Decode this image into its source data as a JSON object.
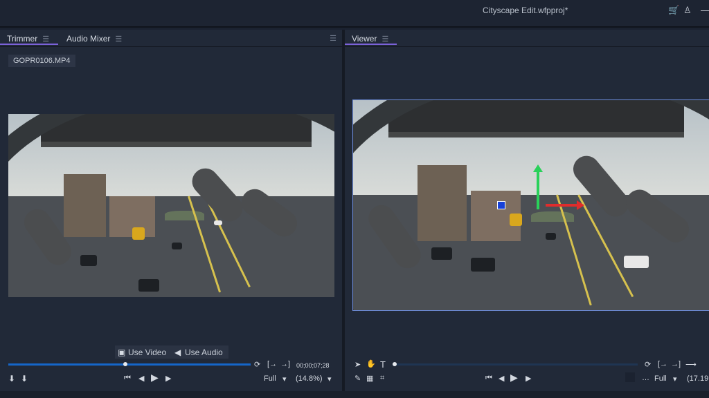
{
  "window": {
    "title": "Cityscape Edit.wfpproj*",
    "icons": [
      "cart-icon",
      "user-icon",
      "minimize-icon"
    ]
  },
  "left_panel": {
    "tabs": [
      {
        "label": "Trimmer",
        "active": true
      },
      {
        "label": "Audio Mixer",
        "active": false
      }
    ],
    "clip_name": "GOPR0106.MP4",
    "source_buttons": {
      "video": "Use Video",
      "audio": "Use Audio"
    },
    "timecode": "00;00;07;28",
    "playback_quality": "Full",
    "zoom": "(14.8%)",
    "timeline_progress": 0.48
  },
  "right_panel": {
    "tab": "Viewer",
    "playback_quality": "Full",
    "zoom": "(17.19",
    "timeline_progress": 0.0
  },
  "colors": {
    "accent": "#7b62d9",
    "selection": "#6f8fde",
    "overlay_blue": "#1741d8",
    "overlay_green": "#29d15a",
    "overlay_red": "#e02c2c"
  }
}
